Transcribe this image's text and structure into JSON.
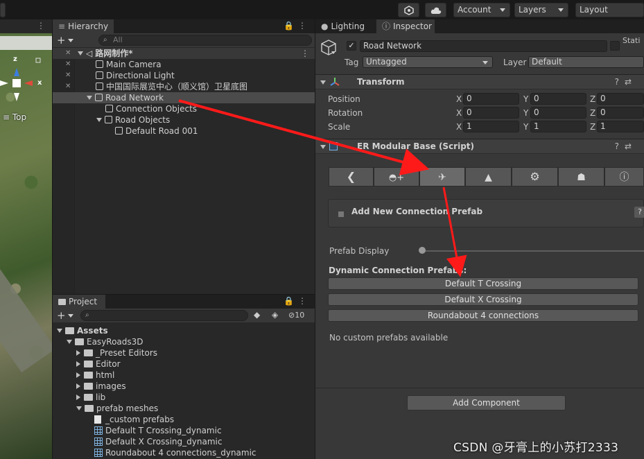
{
  "toolbar": {
    "account_label": "Account",
    "layers_label": "Layers",
    "layout_label": "Layout"
  },
  "scene": {
    "axis_z": "z",
    "axis_x": "x",
    "view_label": "≡ Top"
  },
  "hierarchy": {
    "tab_label": "Hierarchy",
    "search_placeholder": "All",
    "scene_name": "路网制作*",
    "items": [
      {
        "label": "Main Camera"
      },
      {
        "label": "Directional Light"
      },
      {
        "label": "中国国际展览中心（顺义馆）卫星底图"
      },
      {
        "label": "Road Network"
      },
      {
        "label": "Connection Objects"
      },
      {
        "label": "Road Objects"
      },
      {
        "label": "Default Road 001"
      }
    ]
  },
  "project": {
    "tab_label": "Project",
    "hidden_count": "10",
    "items": [
      {
        "label": "Assets"
      },
      {
        "label": "EasyRoads3D"
      },
      {
        "label": "_Preset Editors"
      },
      {
        "label": "Editor"
      },
      {
        "label": "html"
      },
      {
        "label": "images"
      },
      {
        "label": "lib"
      },
      {
        "label": "prefab meshes"
      },
      {
        "label": "_custom prefabs"
      },
      {
        "label": "Default T Crossing_dynamic"
      },
      {
        "label": "Default X Crossing_dynamic"
      },
      {
        "label": "Roundabout 4 connections_dynamic"
      }
    ]
  },
  "inspector": {
    "lighting_tab": "Lighting",
    "inspector_tab": "Inspector",
    "object_name": "Road Network",
    "static_label": "Stati",
    "tag_label": "Tag",
    "tag_value": "Untagged",
    "layer_label": "Layer",
    "layer_value": "Default",
    "transform": {
      "title": "Transform",
      "position_label": "Position",
      "rotation_label": "Rotation",
      "scale_label": "Scale",
      "x_label": "X",
      "y_label": "Y",
      "z_label": "Z",
      "position": {
        "x": "0",
        "y": "0",
        "z": "0"
      },
      "rotation": {
        "x": "0",
        "y": "0",
        "z": "0"
      },
      "scale": {
        "x": "1",
        "y": "1",
        "z": "1"
      }
    },
    "script": {
      "title": "ER Modular Base (Script)",
      "add_prefab_label": "Add New Connection Prefab",
      "help_label": "?",
      "prefab_display_label": "Prefab Display",
      "prefab_display_value": 0.0,
      "dynamic_header": "Dynamic Connection Prefabs:",
      "prefabs": [
        {
          "label": "Default T Crossing"
        },
        {
          "label": "Default X Crossing"
        },
        {
          "label": "Roundabout 4 connections"
        }
      ],
      "no_custom": "No custom prefabs available",
      "toolbar_icons": [
        "back-icon",
        "road-add-icon",
        "connection-icon",
        "terrain-icon",
        "gear-icon",
        "hand-icon",
        "info-icon"
      ]
    },
    "add_component": "Add Component"
  },
  "watermark": "CSDN @牙膏上的小苏打2333",
  "colors": {
    "annotation_arrow": "#ff1a1a",
    "panel_bg": "#383838",
    "field_bg": "#2a2a2a"
  }
}
